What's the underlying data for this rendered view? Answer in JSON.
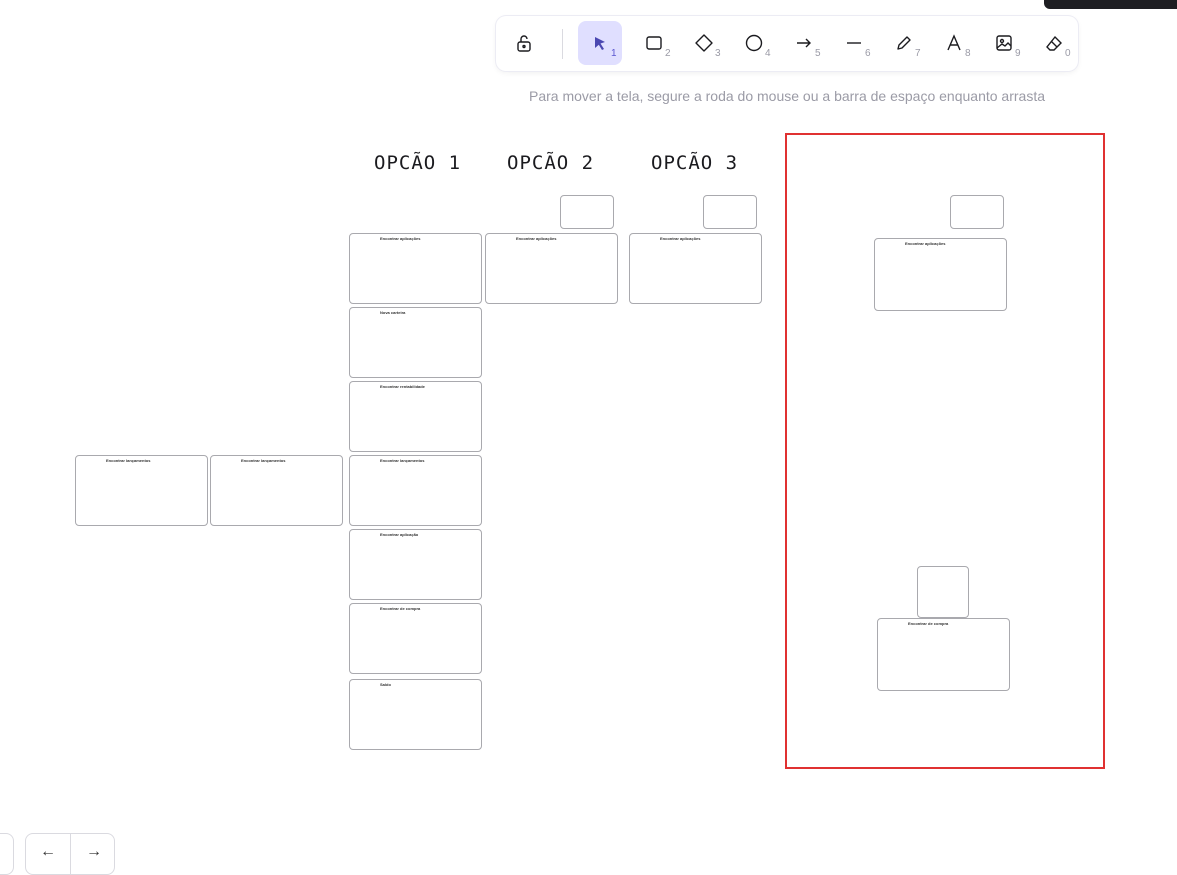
{
  "toolbar": {
    "tools": [
      {
        "name": "lock-icon",
        "key": ""
      },
      {
        "name": "selection-icon",
        "key": "1"
      },
      {
        "name": "rectangle-icon",
        "key": "2"
      },
      {
        "name": "diamond-icon",
        "key": "3"
      },
      {
        "name": "ellipse-icon",
        "key": "4"
      },
      {
        "name": "arrow-icon",
        "key": "5"
      },
      {
        "name": "line-icon",
        "key": "6"
      },
      {
        "name": "draw-icon",
        "key": "7"
      },
      {
        "name": "text-icon",
        "key": "8"
      },
      {
        "name": "image-icon",
        "key": "9"
      },
      {
        "name": "eraser-icon",
        "key": "0"
      }
    ],
    "active_tool": "selection",
    "accent": "#e0dfff"
  },
  "hint": "Para mover a tela, segure a roda do mouse ou a barra de espaço enquanto arrasta",
  "canvas": {
    "headings": [
      "OPCÃO 1",
      "OPCÃO 2",
      "OPCÃO 3"
    ],
    "frames": [
      {
        "id": "opcao1-main",
        "title": "Encontrar aplicações"
      },
      {
        "id": "opcao2-main",
        "title": "Encontrar aplicações"
      },
      {
        "id": "opcao3-main",
        "title": "Encontrar aplicações"
      },
      {
        "id": "row2",
        "title": "Nova carteira"
      },
      {
        "id": "row3",
        "title": "Encontrar rentabilidade"
      },
      {
        "id": "row4",
        "title": "Encontrar lançamentos"
      },
      {
        "id": "row5",
        "title": "Encontrar aplicação"
      },
      {
        "id": "row6",
        "title": "Encontrar de compra"
      },
      {
        "id": "row7",
        "title": "Saldo"
      },
      {
        "id": "left1",
        "title": "Encontrar lançamentos"
      },
      {
        "id": "left2",
        "title": "Encontrar lançamentos"
      },
      {
        "id": "selected-top",
        "title": "Encontrar aplicações"
      },
      {
        "id": "selected-bottom",
        "title": "Encontrar de compra"
      }
    ],
    "selection_color": "#e03131"
  },
  "footer": {
    "undo": "←",
    "redo": "→"
  }
}
